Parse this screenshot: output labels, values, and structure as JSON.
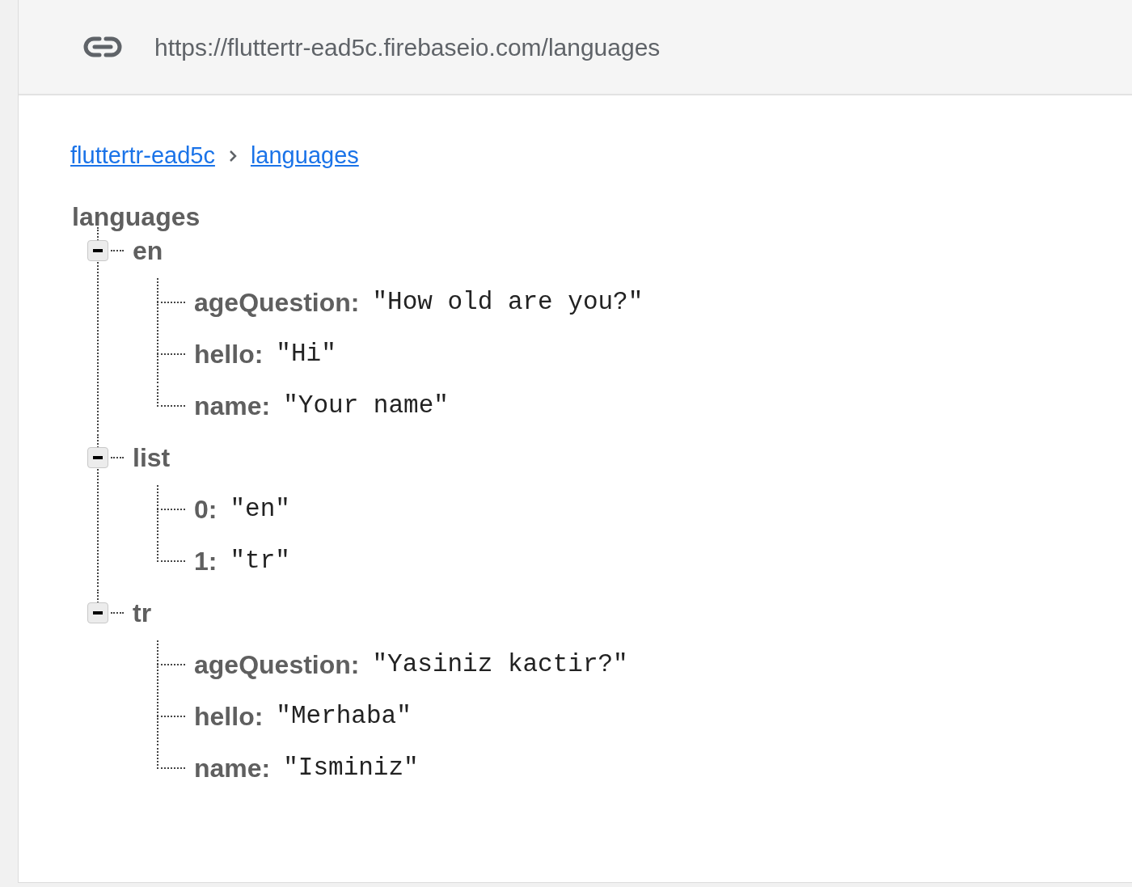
{
  "header": {
    "url": "https://fluttertr-ead5c.firebaseio.com/languages"
  },
  "breadcrumb": [
    {
      "label": "fluttertr-ead5c"
    },
    {
      "label": "languages"
    }
  ],
  "tree": {
    "label": "languages",
    "children": [
      {
        "key": "en",
        "expanded": true,
        "children": [
          {
            "key": "ageQuestion:",
            "value": "\"How old are you?\""
          },
          {
            "key": "hello:",
            "value": "\"Hi\""
          },
          {
            "key": "name:",
            "value": "\"Your name\""
          }
        ]
      },
      {
        "key": "list",
        "expanded": true,
        "children": [
          {
            "key": "0:",
            "value": "\"en\""
          },
          {
            "key": "1:",
            "value": "\"tr\""
          }
        ]
      },
      {
        "key": "tr",
        "expanded": true,
        "children": [
          {
            "key": "ageQuestion:",
            "value": "\"Yasiniz kactir?\""
          },
          {
            "key": "hello:",
            "value": "\"Merhaba\""
          },
          {
            "key": "name:",
            "value": "\"Isminiz\""
          }
        ]
      }
    ]
  }
}
